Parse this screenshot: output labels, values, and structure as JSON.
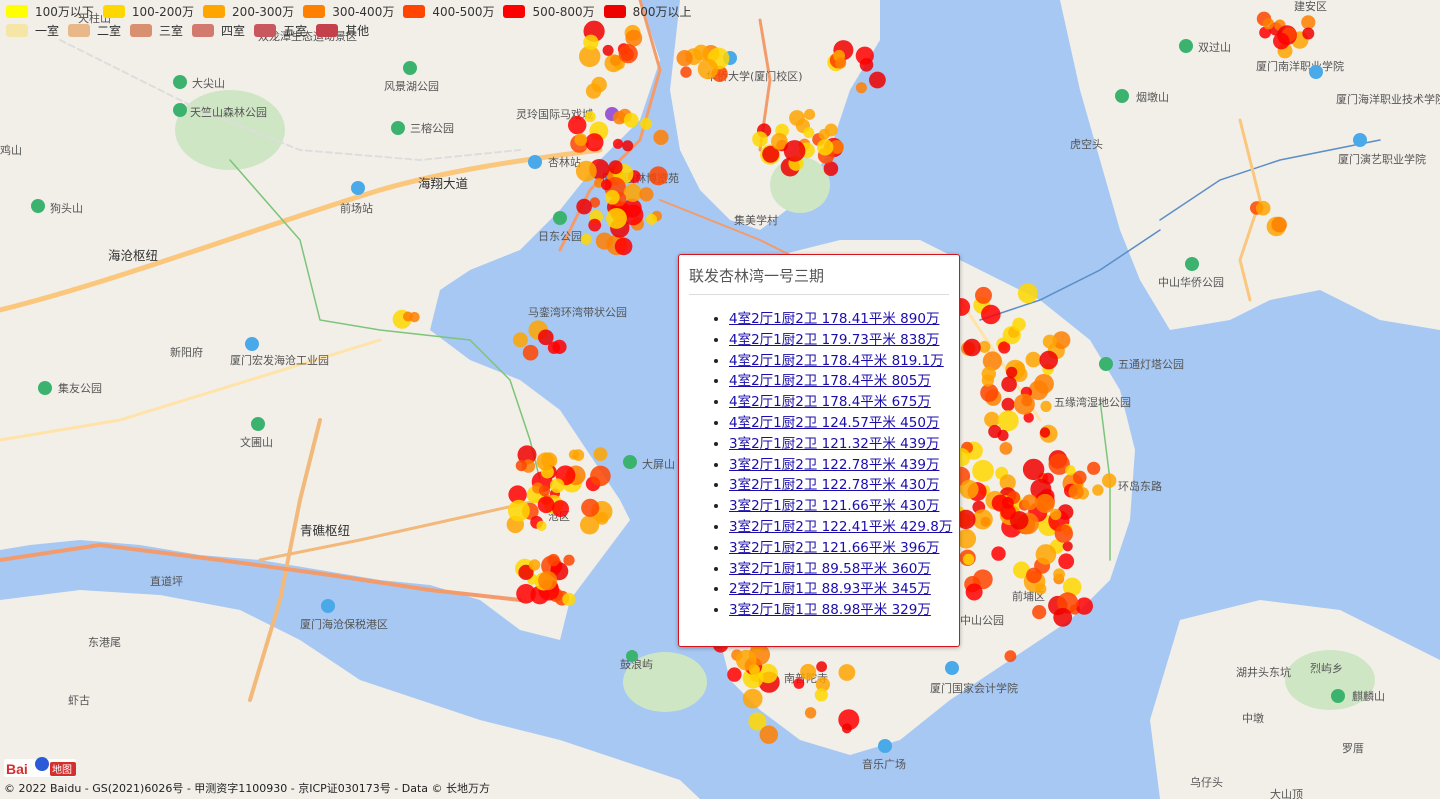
{
  "legend": {
    "price": [
      {
        "label": "100万以下",
        "color": "#ffff00"
      },
      {
        "label": "100-200万",
        "color": "#ffd700"
      },
      {
        "label": "200-300万",
        "color": "#ffa500"
      },
      {
        "label": "300-400万",
        "color": "#ff7f00"
      },
      {
        "label": "400-500万",
        "color": "#ff4500"
      },
      {
        "label": "500-800万",
        "color": "#ff0000"
      },
      {
        "label": "800万以上",
        "color": "#ee0000"
      }
    ],
    "rooms": [
      {
        "label": "一室",
        "color": "#f5e6a8"
      },
      {
        "label": "二室",
        "color": "#e8b889"
      },
      {
        "label": "三室",
        "color": "#d99070"
      },
      {
        "label": "四室",
        "color": "#d27a6e"
      },
      {
        "label": "五室",
        "color": "#c9575e"
      },
      {
        "label": "其他",
        "color": "#c4404a"
      }
    ]
  },
  "popup": {
    "title": "联发杏林湾一号三期",
    "listings": [
      "4室2厅1厨2卫 178.41平米 890万",
      "4室2厅1厨2卫 179.73平米 838万",
      "4室2厅1厨2卫 178.4平米 819.1万",
      "4室2厅1厨2卫 178.4平米 805万",
      "4室2厅1厨2卫 178.4平米 675万",
      "4室2厅1厨2卫 124.57平米 450万",
      "3室2厅1厨2卫 121.32平米 439万",
      "3室2厅1厨2卫 122.78平米 439万",
      "3室2厅1厨2卫 122.78平米 430万",
      "3室2厅1厨2卫 121.66平米 430万",
      "3室2厅1厨2卫 122.41平米 429.8万",
      "3室2厅1厨2卫 121.66平米 396万",
      "3室2厅1厨1卫 89.58平米 360万",
      "2室2厅1厨1卫 88.93平米 345万",
      "3室2厅1厨1卫 88.98平米 329万"
    ]
  },
  "map_labels": {
    "tianzhushan": "天竺山森林公园",
    "dajianshan": "大尖山",
    "fengfuhu": "风景湖公园",
    "sanzhai": "三榕公园",
    "haixiang": "海翔大道",
    "qianchang": "前场站",
    "goutoushan": "狗头山",
    "haicang_hub": "海沧枢纽",
    "jiyou": "集友公园",
    "haicang_ind": "厦门宏发海沧工业园",
    "wenyuanshan": "文圃山",
    "qingjiao": "青礁枢纽",
    "zhijiang": "直道坪",
    "dongganwei": "东港尾",
    "haicang_port": "厦门海沧保税港区",
    "haitou": "虾古",
    "maluan": "马銮湾环湾带状公园",
    "xinyangfu": "新阳府",
    "daping": "大屏山",
    "gulangyu": "鼓浪屿",
    "nanputuo": "南普陀寺",
    "yinyue": "音乐广场",
    "kuaiji": "厦门国家会计学院",
    "zhongshanhuaqiao": "中山华侨公园",
    "wutong": "五通灯塔公园",
    "wuyuan": "五缘湾湿地公园",
    "huandao": "环岛东路",
    "huqiao_univ": "华侨大学(厦门校区)",
    "jimei": "集美学村",
    "yuanlin": "厦门园林博览苑",
    "lingling": "灵玲国际马戏城",
    "xinglin": "杏林站",
    "rilegongyuan": "日东公园",
    "yandunshan": "烟墩山",
    "hukongtou": "虎空头",
    "haiyang": "厦门海洋职业技术学院",
    "yanyi": "厦门演艺职业学院",
    "nanyang": "厦门南洋职业学院",
    "shuangguoshan": "双过山",
    "qilinshan": "麒麟山",
    "huannantou": "湖井头东坑",
    "dashantou": "大山顶",
    "shuanglong": "双龙潭生态运动景区",
    "tianzhu": "天柱山",
    "jishan": "鸡山",
    "luowu": "烈屿乡",
    "zhongdun": "中墩",
    "luozhai": "罗厝",
    "wuzaitou": "乌仔头",
    "jianyang": "建安区",
    "zhongshan2": "中山公园",
    "qianpu": "前埔区",
    "canghai": "沧区"
  },
  "footer": "© 2022 Baidu - GS(2021)6026号 - 甲测资字1100930 - 京ICP证030173号 - Data © 长地万方",
  "logo_text": "Bai地图"
}
